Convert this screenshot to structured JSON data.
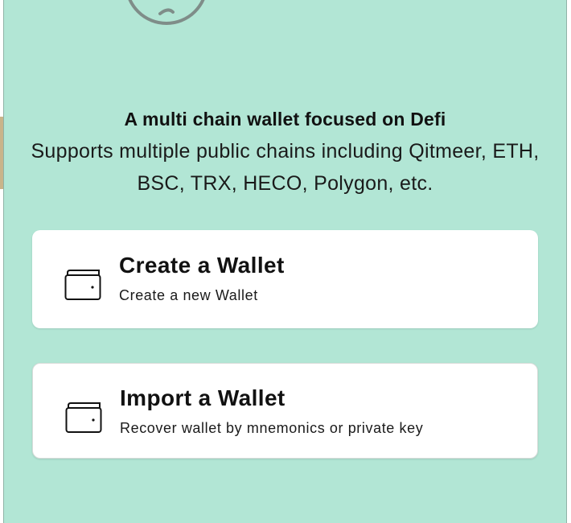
{
  "intro": {
    "tagline": "A multi chain wallet focused on Defi",
    "subtext": "Supports multiple public chains including Qitmeer, ETH, BSC, TRX, HECO, Polygon, etc."
  },
  "actions": [
    {
      "title": "Create a Wallet",
      "description": "Create a new Wallet",
      "icon": "wallet-icon"
    },
    {
      "title": "Import a Wallet",
      "description": "Recover wallet by mnemonics or private key",
      "icon": "wallet-icon"
    }
  ],
  "colors": {
    "panel_background": "#b2e6d5",
    "card_background": "#ffffff",
    "text": "#111111"
  }
}
